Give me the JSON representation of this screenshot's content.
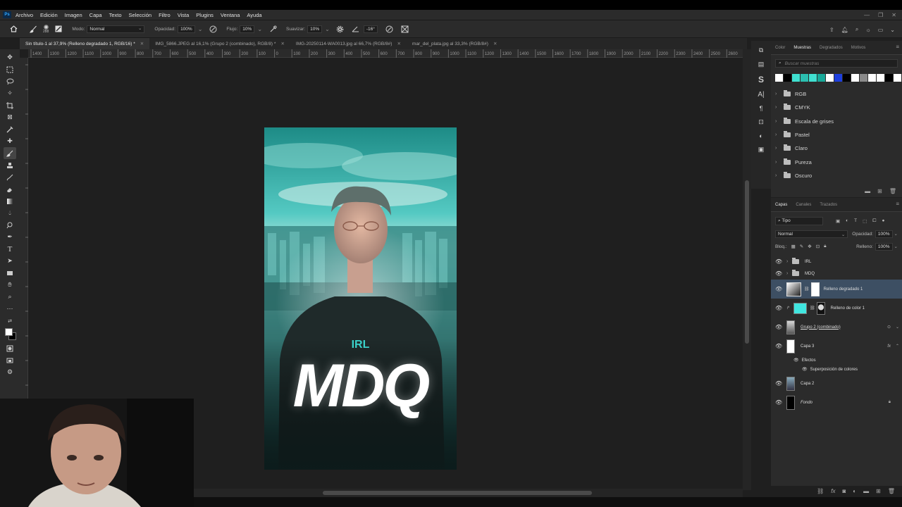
{
  "menubar": {
    "app_logo": "Ps",
    "items": [
      "Archivo",
      "Edición",
      "Imagen",
      "Capa",
      "Texto",
      "Selección",
      "Filtro",
      "Vista",
      "Plugins",
      "Ventana",
      "Ayuda"
    ]
  },
  "options": {
    "brush_size": "288",
    "mode_label": "Modo:",
    "mode_value": "Normal",
    "opacity_label": "Opacidad:",
    "opacity_value": "100%",
    "flow_label": "Flujo:",
    "flow_value": "10%",
    "smoothing_label": "Suavizar:",
    "smoothing_value": "10%",
    "angle_value": "-16°"
  },
  "tabs": [
    {
      "label": "Sin título-1 al 37,9% (Relleno degradado 1, RGB/16) *",
      "active": true
    },
    {
      "label": "IMG_5866.JPEG al 16,1% (Grupo 2 (combinado), RGB/8) *",
      "active": false
    },
    {
      "label": "IMG-20250114-WA0013.jpg al 66,7% (RGB/8#)",
      "active": false
    },
    {
      "label": "mar_del_plata.jpg al 33,3% (RGB/8#)",
      "active": false
    }
  ],
  "ruler": {
    "labels": [
      "1400",
      "1300",
      "1200",
      "1100",
      "1000",
      "900",
      "800",
      "700",
      "600",
      "500",
      "400",
      "300",
      "200",
      "100",
      "0",
      "100",
      "200",
      "300",
      "400",
      "500",
      "600",
      "700",
      "800",
      "900",
      "1000",
      "1100",
      "1200",
      "1300",
      "1400",
      "1500",
      "1600",
      "1700",
      "1800",
      "1900",
      "2000",
      "2100",
      "2200",
      "2300",
      "2400",
      "2500",
      "2600"
    ]
  },
  "poster": {
    "tagline": "IRL",
    "title": "MDQ"
  },
  "swatches_panel": {
    "tabs": [
      "Color",
      "Muestras",
      "Degradados",
      "Motivos"
    ],
    "active_tab": "Muestras",
    "search_placeholder": "Buscar muestras",
    "swatch_colors": [
      "#ffffff",
      "#000000",
      "#3fe0d0",
      "#2bbfb0",
      "#40e0d0",
      "#18a999",
      "#ffffff",
      "#1e3fdd",
      "#000000",
      "#ffffff",
      "#8a8a8a",
      "#ffffff",
      "#ffffff",
      "#000000",
      "#ffffff"
    ],
    "groups": [
      "RGB",
      "CMYK",
      "Escala de grises",
      "Pastel",
      "Claro",
      "Pureza",
      "Oscuro"
    ]
  },
  "layers_panel": {
    "tabs": [
      "Capas",
      "Canales",
      "Trazados"
    ],
    "active_tab": "Capas",
    "filter_value": "Tipo",
    "blend_mode": "Normal",
    "opacity_label": "Opacidad:",
    "opacity_value": "100%",
    "lock_label": "Bloq.:",
    "fill_label": "Relleno:",
    "fill_value": "100%",
    "layers": [
      {
        "name": "IRL",
        "type": "group"
      },
      {
        "name": "MDQ",
        "type": "group"
      },
      {
        "name": "Relleno degradado 1",
        "type": "gradient",
        "selected": true
      },
      {
        "name": "Relleno de color 1",
        "type": "color",
        "color": "#40e6e0"
      },
      {
        "name": "Grupo 2 (combinado)",
        "type": "smart"
      },
      {
        "name": "Capa 3",
        "type": "pixel",
        "fx": "fx"
      },
      {
        "name": "Efectos",
        "type": "effects-header"
      },
      {
        "name": "Superposición de colores",
        "type": "effect"
      },
      {
        "name": "Capa 2",
        "type": "pixel"
      },
      {
        "name": "Fondo",
        "type": "background"
      }
    ]
  },
  "colors": {
    "accent_teal": "#40e0d0",
    "selected_layer": "#3d4f63",
    "panel_bg": "#2b2b2b"
  }
}
